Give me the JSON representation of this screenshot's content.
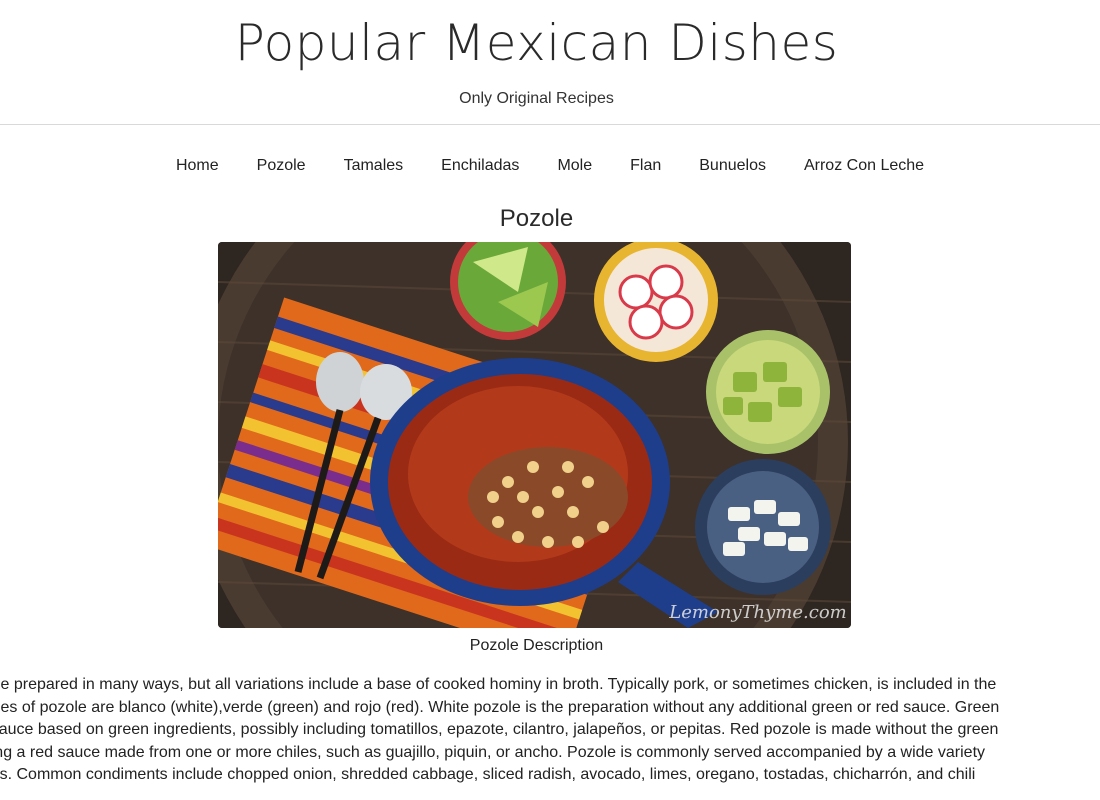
{
  "header": {
    "site_title": "Popular Mexican Dishes",
    "tagline": "Only Original Recipes"
  },
  "nav": {
    "items": [
      {
        "label": "Home"
      },
      {
        "label": "Pozole"
      },
      {
        "label": "Tamales"
      },
      {
        "label": "Enchiladas"
      },
      {
        "label": "Mole"
      },
      {
        "label": "Flan"
      },
      {
        "label": "Bunuelos"
      },
      {
        "label": "Arroz Con Leche"
      }
    ]
  },
  "main": {
    "heading": "Pozole",
    "image": {
      "watermark": "LemonyThyme.com"
    },
    "caption": "Pozole Description",
    "description_lines": [
      "Pozole can be prepared in many ways, but all variations include a base of cooked hominy in broth. Typically pork, or sometimes chicken, is included in the",
      "The main types of pozole are blanco (white),verde (green) and rojo (red). White pozole is the preparation without any additional green or red sauce. Green",
      "adds a rich sauce based on green ingredients, possibly including tomatillos, epazote, cilantro, jalapeños, or pepitas. Red pozole is made without the green",
      "instead adding a red sauce made from one or more chiles, such as guajillo, piquin, or ancho. Pozole is commonly served accompanied by a wide variety",
      "of condiments. Common condiments include chopped onion, shredded cabbage, sliced radish, avocado, limes, oregano, tostadas, chicharrón, and chili"
    ]
  }
}
